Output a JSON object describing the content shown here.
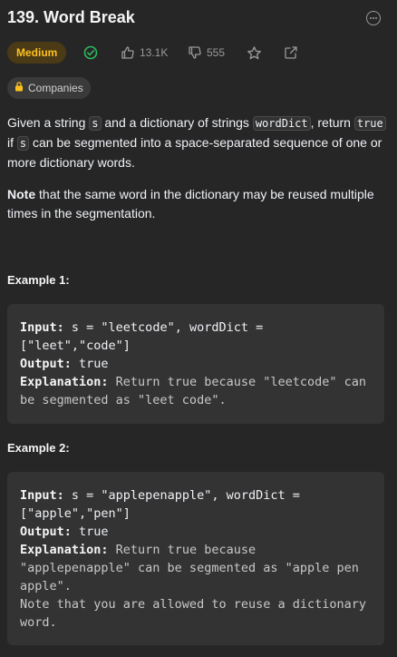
{
  "problem": {
    "title": "139. Word Break",
    "difficulty": "Medium",
    "likes": "13.1K",
    "dislikes": "555",
    "companies_label": "Companies"
  },
  "description": {
    "p1_a": "Given a string ",
    "p1_code1": "s",
    "p1_b": " and a dictionary of strings ",
    "p1_code2": "wordDict",
    "p1_c": ", return ",
    "p1_code3": "true",
    "p1_d": " if ",
    "p1_code4": "s",
    "p1_e": " can be segmented into a space-separated sequence of one or more dictionary words.",
    "note_bold": "Note",
    "note_rest": " that the same word in the dictionary may be reused multiple times in the segmentation."
  },
  "examples": [
    {
      "title": "Example 1:",
      "input_label": "Input:",
      "input_value": " s = \"leetcode\", wordDict = [\"leet\",\"code\"]",
      "output_label": "Output:",
      "output_value": " true",
      "explanation_label": "Explanation:",
      "explanation_value": " Return true because \"leetcode\" can be segmented as \"leet code\"."
    },
    {
      "title": "Example 2:",
      "input_label": "Input:",
      "input_value": " s = \"applepenapple\", wordDict = [\"apple\",\"pen\"]",
      "output_label": "Output:",
      "output_value": " true",
      "explanation_label": "Explanation:",
      "explanation_value": " Return true because \"applepenapple\" can be segmented as \"apple pen apple\".",
      "note": "Note that you are allowed to reuse a dictionary word."
    }
  ],
  "colors": {
    "background": "#262626",
    "medium_badge_bg": "#4a3a16",
    "medium_badge_text": "#ffc01e",
    "solved_check": "#2cbb5d",
    "muted_text": "#9a9a9a"
  },
  "icons": [
    "more-icon",
    "solved-check-icon",
    "thumbs-up-icon",
    "thumbs-down-icon",
    "star-icon",
    "share-icon",
    "lock-icon"
  ]
}
